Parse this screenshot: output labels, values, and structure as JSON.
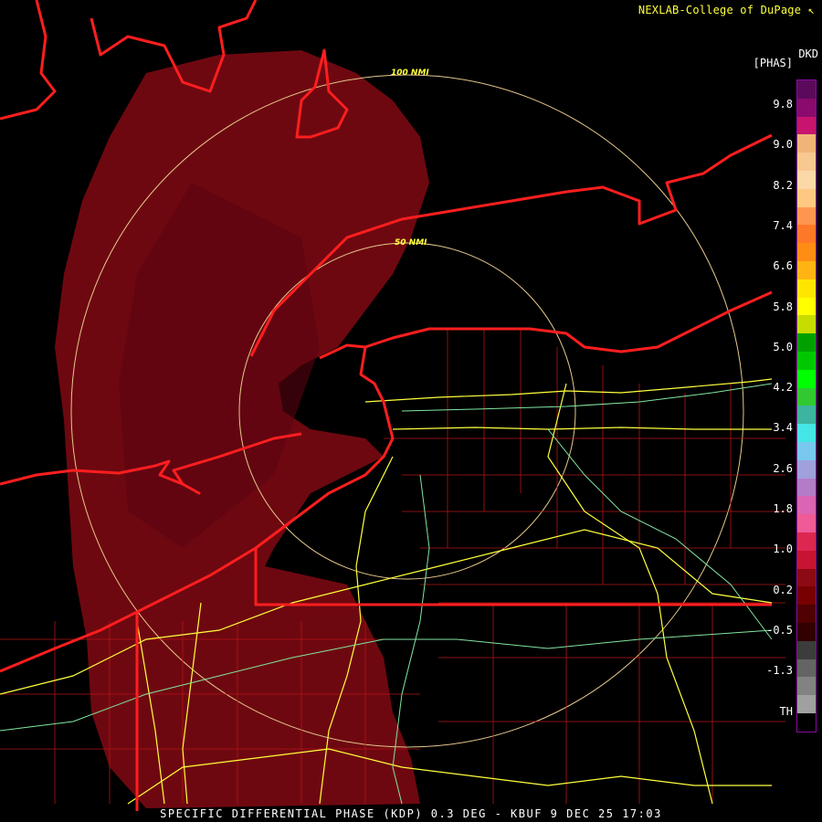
{
  "header": {
    "credit": "NEXLAB-College of DuPage",
    "credit_icon": "r-logo-icon"
  },
  "legend": {
    "product_code": "DKD",
    "unit": "[PHAS]",
    "tick_labels": [
      "9.8",
      "9.0",
      "8.2",
      "7.4",
      "6.6",
      "5.8",
      "5.0",
      "4.2",
      "3.4",
      "2.6",
      "1.8",
      "1.0",
      "0.2",
      "-0.5",
      "-1.3",
      "TH"
    ],
    "colors": [
      "#5b0a5b",
      "#8a0a6e",
      "#c8146e",
      "#f0b478",
      "#f7c890",
      "#fbd8a8",
      "#ffc882",
      "#ff9650",
      "#ff7828",
      "#ff8c14",
      "#ffb414",
      "#ffe600",
      "#ffff00",
      "#c8dc00",
      "#00a000",
      "#00c800",
      "#00ff00",
      "#32c832",
      "#3cb4a0",
      "#46e6e6",
      "#78c8f0",
      "#a0a0dc",
      "#b47cc8",
      "#dc64b4",
      "#f05a96",
      "#dc2850",
      "#c81432",
      "#8c0a14",
      "#780000",
      "#500000",
      "#320000",
      "#3c3c3c",
      "#646464",
      "#828282",
      "#a0a0a0",
      "#000000"
    ]
  },
  "range_rings": [
    {
      "label": "100 NMI"
    },
    {
      "label": "50 NMI"
    }
  ],
  "map": {
    "echo_color": "#6e0810",
    "echo_dark_color": "#5a0410",
    "ring_color": "#e6c88c",
    "border_color": "#ff1e1e",
    "county_color": "#b41414",
    "road_color": "#ffff3c",
    "road2_color": "#82e6a0"
  },
  "footer": {
    "caption": "SPECIFIC DIFFERENTIAL PHASE (KDP) 0.3 DEG - KBUF 9 DEC 25 17:03"
  }
}
